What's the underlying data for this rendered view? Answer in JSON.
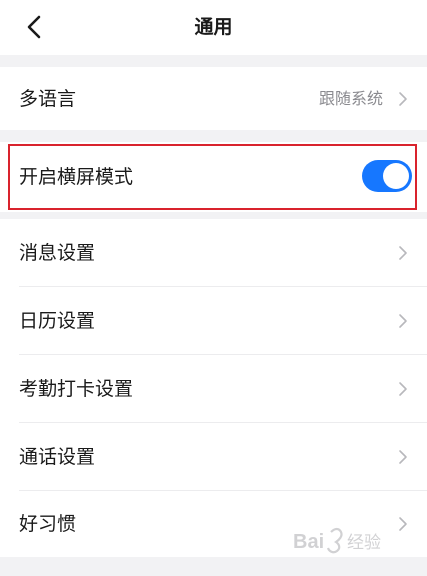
{
  "header": {
    "title": "通用"
  },
  "language_row": {
    "label": "多语言",
    "value": "跟随系统"
  },
  "landscape_row": {
    "label": "开启横屏模式",
    "toggle_on": true,
    "toggle_color": "#1677ff"
  },
  "settings_list": [
    {
      "label": "消息设置"
    },
    {
      "label": "日历设置"
    },
    {
      "label": "考勤打卡设置"
    },
    {
      "label": "通话设置"
    },
    {
      "label": "好习惯"
    }
  ],
  "colors": {
    "highlight_border": "#d9232d",
    "background": "#f2f2f4"
  },
  "watermark": {
    "text": "Bai 经验"
  }
}
